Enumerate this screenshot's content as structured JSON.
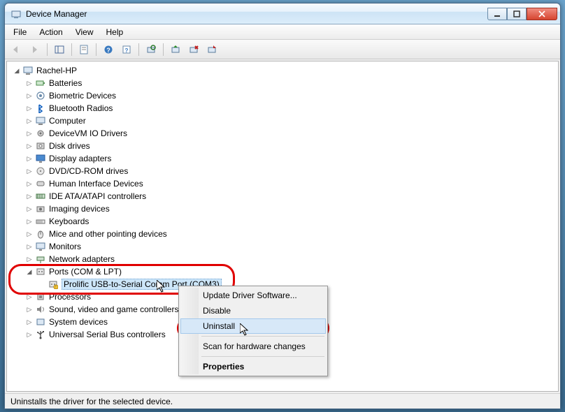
{
  "window": {
    "title": "Device Manager"
  },
  "menu": {
    "file": "File",
    "action": "Action",
    "view": "View",
    "help": "Help"
  },
  "tree": {
    "root": "Rachel-HP",
    "items": [
      "Batteries",
      "Biometric Devices",
      "Bluetooth Radios",
      "Computer",
      "DeviceVM IO Drivers",
      "Disk drives",
      "Display adapters",
      "DVD/CD-ROM drives",
      "Human Interface Devices",
      "IDE ATA/ATAPI controllers",
      "Imaging devices",
      "Keyboards",
      "Mice and other pointing devices",
      "Monitors",
      "Network adapters",
      "Ports (COM & LPT)",
      "Processors",
      "Sound, video and game controllers",
      "System devices",
      "Universal Serial Bus controllers"
    ],
    "ports_child": "Prolific USB-to-Serial Comm Port (COM3)"
  },
  "context_menu": {
    "update": "Update Driver Software...",
    "disable": "Disable",
    "uninstall": "Uninstall",
    "scan": "Scan for hardware changes",
    "properties": "Properties"
  },
  "status": {
    "text": "Uninstalls the driver for the selected device."
  }
}
